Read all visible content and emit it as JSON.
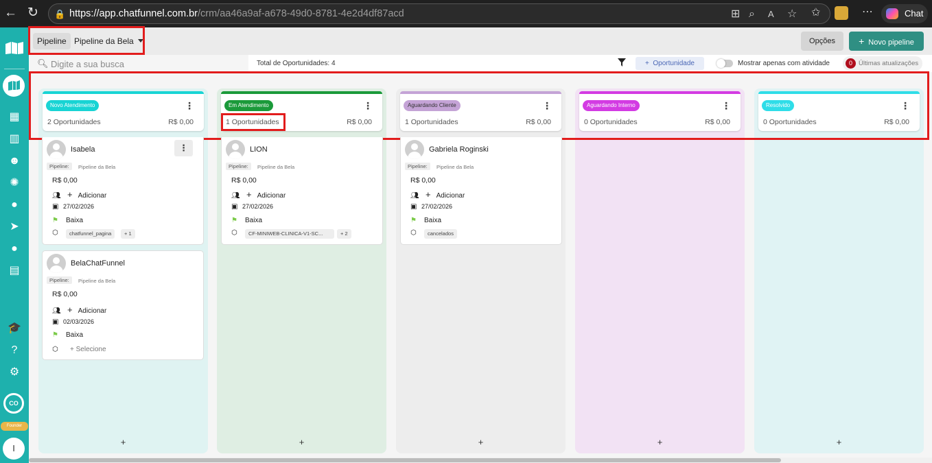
{
  "browser": {
    "url_host": "https://app.chatfunnel.com.br",
    "url_path": "/crm/aa46a9af-a678-49d0-8781-4e2d4df87acd",
    "chat_label": "Chat"
  },
  "sidebar": {
    "avatar_initials": "CO",
    "founder_label": "Founder",
    "user_initial": "I"
  },
  "toolbar": {
    "pipeline_label": "Pipeline",
    "pipeline_selected": "Pipeline da Bela",
    "options_label": "Opções",
    "new_pipeline_label": "Novo pipeline"
  },
  "filters": {
    "search_placeholder": "Digite a sua busca",
    "total_label": "Total de Oportunidades: 4",
    "add_opportunity_label": "Oportunidade",
    "toggle_label": "Mostrar apenas com atividade",
    "updates_count": "0",
    "updates_label": "Últimas atualizações"
  },
  "columns": [
    {
      "stage": "Novo Atendimento",
      "count": "2 Oportunidades",
      "value": "R$ 0,00",
      "color": "#18d4d4",
      "bg": "#dff3f2",
      "add": "+"
    },
    {
      "stage": "Em Atendimento",
      "count": "1 Oportunidades",
      "value": "R$ 0,00",
      "color": "#1b9a3a",
      "bg": "#dfeee3",
      "add": "+"
    },
    {
      "stage": "Aguardando Cliente",
      "count": "1 Oportunidades",
      "value": "R$ 0,00",
      "color": "#c4a3d6",
      "bg": "#ededed",
      "add": "+"
    },
    {
      "stage": "Aguardando Interno",
      "count": "0 Oportunidades",
      "value": "R$ 0,00",
      "color": "#d33be3",
      "bg": "#f2e2f4",
      "add": "+"
    },
    {
      "stage": "Resolvido",
      "count": "0 Oportunidades",
      "value": "R$ 0,00",
      "color": "#2fdde8",
      "bg": "#e0f3f4",
      "add": "+"
    }
  ],
  "cards": [
    {
      "name": "Isabela",
      "pipeline_tag": "Pipeline:",
      "pipeline_name": "Pipeline da Bela",
      "value": "R$ 0,00",
      "add": "Adicionar",
      "date": "27/02/2026",
      "priority": "Baixa",
      "tag1": "chatfunnel_pagina",
      "tag2": "+ 1"
    },
    {
      "name": "BelaChatFunnel",
      "pipeline_tag": "Pipeline:",
      "pipeline_name": "Pipeline da Bela",
      "value": "R$ 0,00",
      "add": "Adicionar",
      "date": "02/03/2026",
      "priority": "Baixa",
      "select": "+ Selecione"
    },
    {
      "name": "LION",
      "pipeline_tag": "Pipeline:",
      "pipeline_name": "Pipeline da Bela",
      "value": "R$ 0,00",
      "add": "Adicionar",
      "date": "27/02/2026",
      "priority": "Baixa",
      "tag1": "CF-MINIWEB-CLINICA-V1-SC...",
      "tag2": "+ 2"
    },
    {
      "name": "Gabriela Roginski",
      "pipeline_tag": "Pipeline:",
      "pipeline_name": "Pipeline da Bela",
      "value": "R$ 0,00",
      "add": "Adicionar",
      "date": "27/02/2026",
      "priority": "Baixa",
      "tag1": "cancelados"
    }
  ]
}
